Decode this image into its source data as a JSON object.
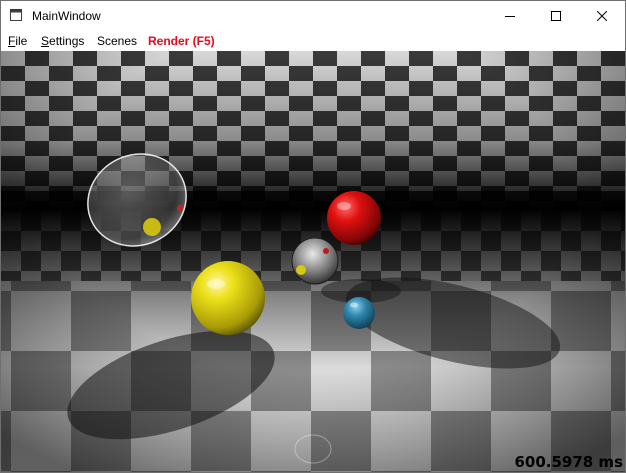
{
  "window": {
    "title": "MainWindow",
    "controls": {
      "minimize": "minimize-icon",
      "maximize": "maximize-icon",
      "close": "close-icon"
    }
  },
  "menu": {
    "file": {
      "mnemonic": "F",
      "rest": "ile"
    },
    "settings": {
      "mnemonic": "S",
      "rest": "ettings"
    },
    "scenes": {
      "label": "Scenes"
    },
    "render": {
      "label": "Render (F5)",
      "color": "#e8091c"
    }
  },
  "viewport": {
    "render_time": "600.5978 ms",
    "scene": {
      "floor": "checkerboard",
      "spheres": [
        {
          "name": "glass sphere",
          "color": "transparent"
        },
        {
          "name": "red sphere",
          "color": "#d81010"
        },
        {
          "name": "mirror sphere",
          "color": "chrome"
        },
        {
          "name": "yellow sphere",
          "color": "#e8dc10"
        },
        {
          "name": "blue sphere",
          "color": "#2a7fa8"
        }
      ]
    }
  }
}
